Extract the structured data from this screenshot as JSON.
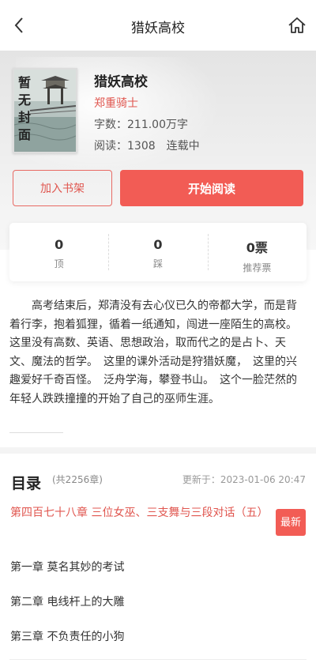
{
  "header": {
    "title": "猎妖高校",
    "back_icon": "chevron-left-icon",
    "home_icon": "home-icon"
  },
  "book": {
    "cover_text": "暂无封面",
    "title": "猎妖高校",
    "author": "郑重骑士",
    "words": "字数：211.00万字",
    "reads": "阅读：1308",
    "status": "连载中"
  },
  "actions": {
    "add_shelf": "加入书架",
    "start_reading": "开始阅读"
  },
  "stats": [
    {
      "value": "0",
      "label": "顶"
    },
    {
      "value": "0",
      "label": "踩"
    },
    {
      "value": "0票",
      "label": "推荐票"
    }
  ],
  "intro": "高考结束后，郑清没有去心仪已久的帝都大学，而是背着行李，抱着狐狸，循着一纸通知，闯进一座陌生的高校。　这里没有高数、英语、思想政治，取而代之的是占卜、天文、魔法的哲学。　这里的课外活动是狩猎妖魔，　这里的兴趣爱好千奇百怪。　泛舟学海，攀登书山。　这个一脸茫然的年轻人跌跌撞撞的开始了自己的巫师生涯。",
  "toc": {
    "title": "目录",
    "count": "(共2256章)",
    "updated": "更新于：2023-01-06 20:47",
    "latest": {
      "title": "第四百七十八章 三位女巫、三支舞与三段对话（五）",
      "badge": "最新"
    },
    "chapters": [
      "第一章 莫名其妙的考试",
      "第二章 电线杆上的大雕",
      "第三章 不负责任的小狗"
    ]
  },
  "colors": {
    "accent": "#f25c55",
    "accent_text": "#e0564f"
  }
}
